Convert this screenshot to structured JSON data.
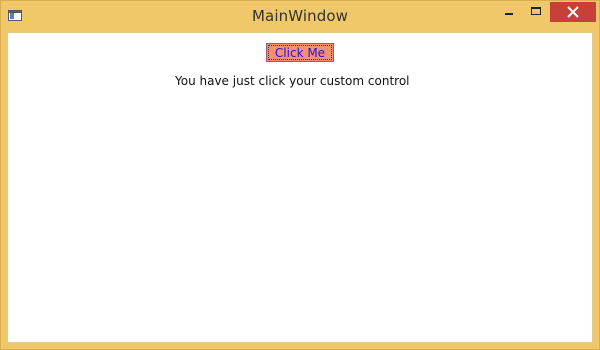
{
  "window": {
    "title": "MainWindow",
    "frame_color": "#f0c869",
    "close_color": "#c7403a",
    "icons": {
      "app": "window-app-icon",
      "minimize": "minimize-icon",
      "maximize": "maximize-icon",
      "close": "close-icon"
    }
  },
  "content": {
    "button": {
      "label": "Click Me",
      "background": "#f2906f",
      "text_color": "#2a12d6"
    },
    "message": "You have just click your custom control"
  }
}
